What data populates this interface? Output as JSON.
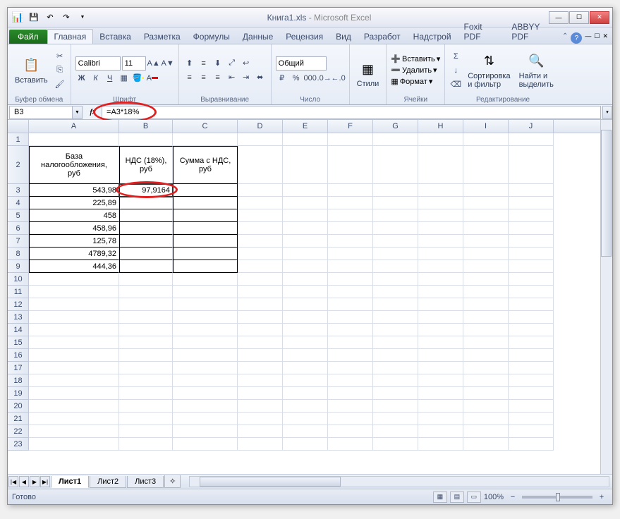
{
  "title": {
    "doc": "Книга1.xls",
    "app": "Microsoft Excel"
  },
  "qat": {
    "save": "💾",
    "undo": "↶",
    "redo": "↷"
  },
  "winbtns": {
    "min": "—",
    "max": "☐",
    "close": "✕"
  },
  "tabs": {
    "file": "Файл",
    "home": "Главная",
    "insert": "Вставка",
    "layout": "Разметка",
    "formulas": "Формулы",
    "data": "Данные",
    "review": "Рецензия",
    "view": "Вид",
    "developer": "Разработ",
    "addins": "Надстрой",
    "foxit": "Foxit PDF",
    "abbyy": "ABBYY PDF"
  },
  "ribbon": {
    "clipboard": {
      "label": "Буфер обмена",
      "paste": "Вставить"
    },
    "font": {
      "label": "Шрифт",
      "name": "Calibri",
      "size": "11"
    },
    "align": {
      "label": "Выравнивание"
    },
    "number": {
      "label": "Число",
      "format": "Общий"
    },
    "styles": {
      "label": "",
      "btn": "Стили"
    },
    "cells": {
      "label": "Ячейки",
      "insert": "Вставить",
      "delete": "Удалить",
      "format": "Формат"
    },
    "editing": {
      "label": "Редактирование",
      "sort": "Сортировка\nи фильтр",
      "find": "Найти и\nвыделить"
    }
  },
  "namebox": "B3",
  "formula": "=A3*18%",
  "columns": [
    "A",
    "B",
    "C",
    "D",
    "E",
    "F",
    "G",
    "H",
    "I",
    "J"
  ],
  "headerRow": {
    "A": "База\nналогообложения,\nруб",
    "B": "НДС (18%),\nруб",
    "C": "Сумма с НДС,\nруб"
  },
  "rows": [
    {
      "n": 3,
      "A": "543,98",
      "B": "97,9164",
      "C": ""
    },
    {
      "n": 4,
      "A": "225,89",
      "B": "",
      "C": ""
    },
    {
      "n": 5,
      "A": "458",
      "B": "",
      "C": ""
    },
    {
      "n": 6,
      "A": "458,96",
      "B": "",
      "C": ""
    },
    {
      "n": 7,
      "A": "125,78",
      "B": "",
      "C": ""
    },
    {
      "n": 8,
      "A": "4789,32",
      "B": "",
      "C": ""
    },
    {
      "n": 9,
      "A": "444,36",
      "B": "",
      "C": ""
    }
  ],
  "emptyRows": [
    1,
    10,
    11,
    12,
    13,
    14,
    15,
    16,
    17,
    18,
    19,
    20,
    21,
    22,
    23
  ],
  "sheets": {
    "s1": "Лист1",
    "s2": "Лист2",
    "s3": "Лист3"
  },
  "status": {
    "ready": "Готово",
    "zoom": "100%"
  }
}
